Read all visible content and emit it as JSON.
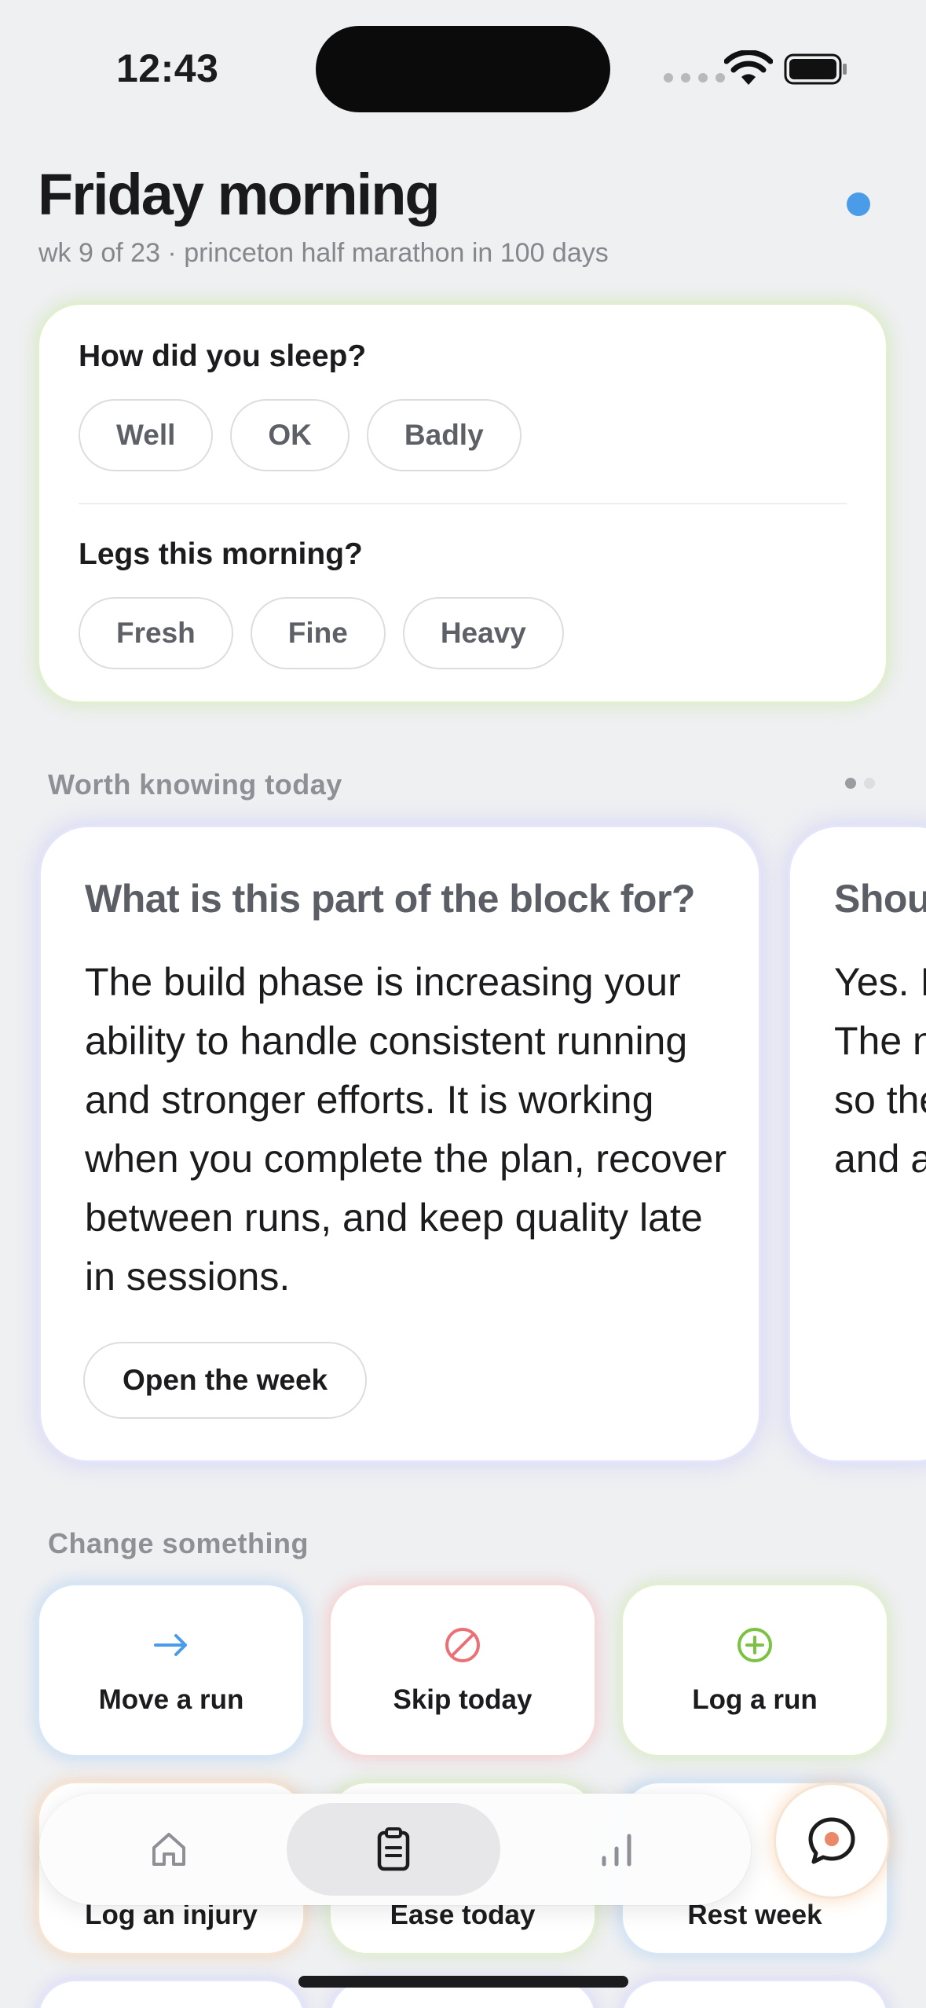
{
  "status_bar": {
    "time": "12:43"
  },
  "header": {
    "title": "Friday morning",
    "subtitle": "wk 9 of 23 · princeton half marathon in 100 days"
  },
  "checkin": {
    "sleep_question": "How did you sleep?",
    "sleep_options": [
      "Well",
      "OK",
      "Badly"
    ],
    "legs_question": "Legs this morning?",
    "legs_options": [
      "Fresh",
      "Fine",
      "Heavy"
    ]
  },
  "worth_knowing": {
    "section_label": "Worth knowing today",
    "cards": [
      {
        "title": "What is this part of the block for?",
        "body": "The build phase is increasing your ability to handle consistent running and stronger efforts. It is working when you complete the plan, recover between runs, and keep quality late in sessions.",
        "button": "Open the week"
      },
      {
        "title": "Shou",
        "body_lines": [
          "Yes. I",
          "The n",
          "so the",
          "and a"
        ]
      }
    ]
  },
  "change_something": {
    "section_label": "Change something",
    "tiles_row1": [
      {
        "label": "Move a run",
        "icon": "arrow-right-icon",
        "color": "#4a9be8"
      },
      {
        "label": "Skip today",
        "icon": "prohibited-icon",
        "color": "#ec6f76"
      },
      {
        "label": "Log a run",
        "icon": "plus-circle-icon",
        "color": "#7bc242"
      }
    ],
    "tiles_row2": [
      {
        "label": "Log an injury"
      },
      {
        "label": "Ease today"
      },
      {
        "label": "Rest week"
      }
    ]
  },
  "tabbar": {
    "tabs": [
      {
        "name": "home",
        "icon": "house-icon"
      },
      {
        "name": "plan",
        "icon": "clipboard-icon",
        "selected": true
      },
      {
        "name": "stats",
        "icon": "bar-chart-icon"
      }
    ],
    "fab_icon": "chat-bubble-icon"
  },
  "colors": {
    "accent_blue": "#4a9be8",
    "skip_red": "#ec6f76",
    "log_green": "#7bc242",
    "background": "#eff0f2"
  }
}
